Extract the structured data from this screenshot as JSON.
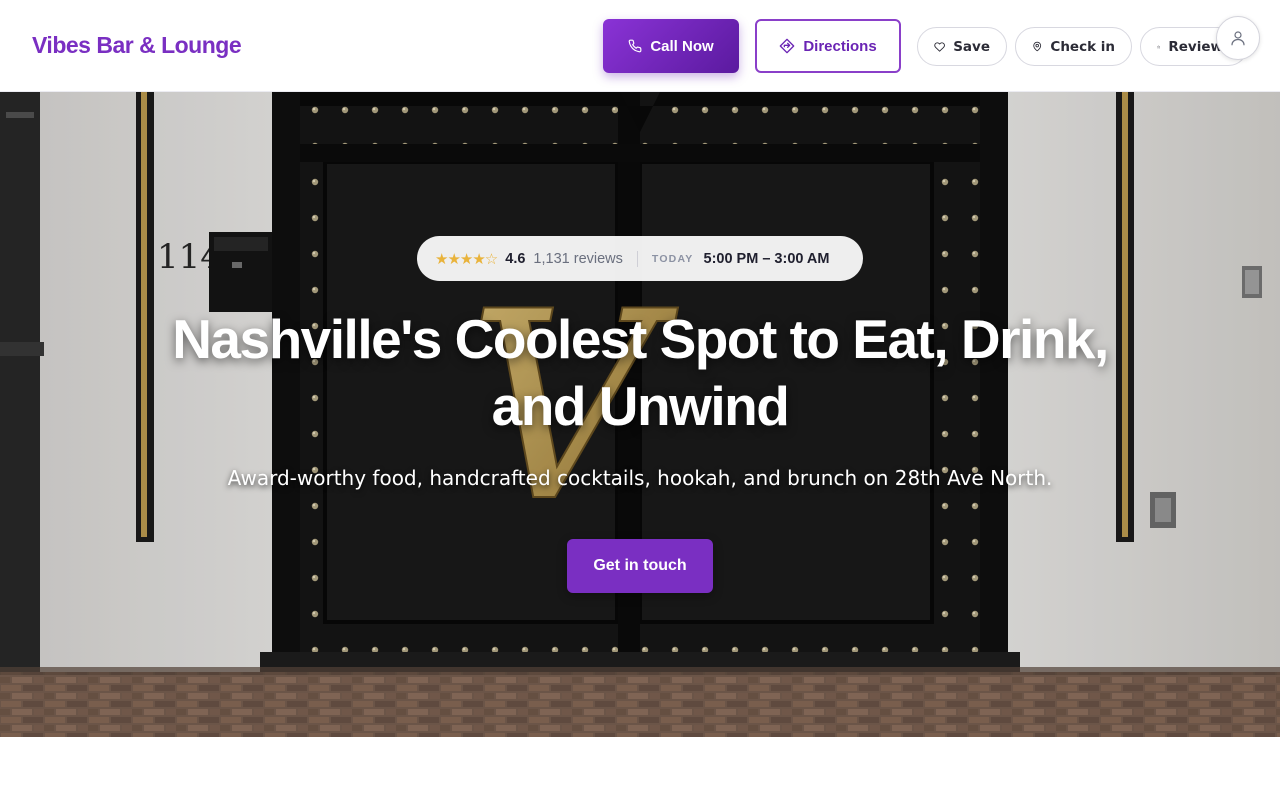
{
  "header": {
    "brand": "Vibes Bar & Lounge",
    "call_label": "Call Now",
    "directions_label": "Directions",
    "save_label": "Save",
    "checkin_label": "Check in",
    "reviews_label": "Reviews"
  },
  "hero": {
    "stars": "★★★★☆",
    "rating": "4.6",
    "review_count": "1,131 reviews",
    "today_label": "TODAY",
    "hours": "5:00 PM – 3:00 AM",
    "headline": "Nashville's Coolest Spot to Eat, Drink, and Unwind",
    "subheadline": "Award-worthy food, handcrafted cocktails, hookah, and brunch on 28th Ave North.",
    "cta_label": "Get in touch",
    "address_number": "114",
    "door_letter": "V"
  },
  "icons": {
    "call": "phone-icon",
    "directions": "directions-icon",
    "save": "heart-icon",
    "checkin": "map-pin-icon",
    "reviews": "star-icon",
    "account": "user-icon"
  },
  "colors": {
    "brand": "#7a2fc2",
    "accent_dark": "#5b1a9f",
    "star": "#e9b33b",
    "door": "#161616",
    "brass": "#c2a052"
  }
}
